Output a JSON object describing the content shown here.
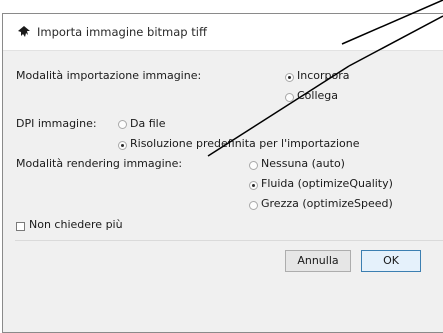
{
  "dialog": {
    "title": "Importa immagine bitmap tiff",
    "app_icon": "inkscape-icon"
  },
  "import_mode": {
    "label": "Modalità importazione immagine:",
    "options": [
      {
        "label": "Incorpora",
        "checked": true
      },
      {
        "label": "Collega",
        "checked": false
      }
    ]
  },
  "dpi": {
    "label": "DPI immagine:",
    "options": [
      {
        "label": "Da file",
        "checked": false
      },
      {
        "label": "Risoluzione predefinita per l'importazione",
        "checked": true
      }
    ]
  },
  "render_mode": {
    "label": "Modalità rendering immagine:",
    "options": [
      {
        "label": "Nessuna (auto)",
        "checked": false
      },
      {
        "label": "Fluida (optimizeQuality)",
        "checked": true
      },
      {
        "label": "Grezza (optimizeSpeed)",
        "checked": false
      }
    ]
  },
  "dont_ask": {
    "label": "Non chiedere più",
    "checked": false
  },
  "buttons": {
    "cancel": "Annulla",
    "ok": "OK"
  },
  "annotation_color": "#000000"
}
